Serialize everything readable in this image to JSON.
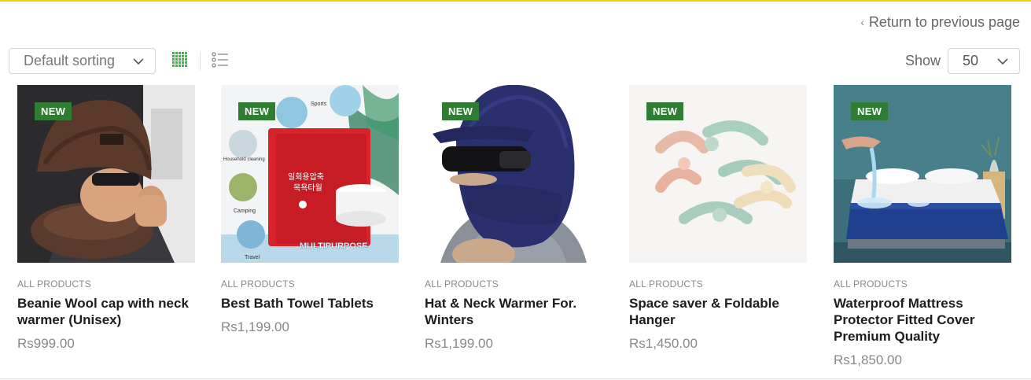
{
  "nav": {
    "return_label": "Return to previous page"
  },
  "toolbar": {
    "sort_value": "Default sorting",
    "show_label": "Show",
    "show_value": "50"
  },
  "products": [
    {
      "badge": "NEW",
      "category": "ALL PRODUCTS",
      "title": "Beanie Wool cap with neck warmer (Unisex)",
      "price": "Rs999.00"
    },
    {
      "badge": "NEW",
      "category": "ALL PRODUCTS",
      "title": "Best Bath Towel Tablets",
      "price": "Rs1,199.00",
      "image_text": {
        "sports": "Sports",
        "household": "Household cleaning",
        "camping": "Camping",
        "travel": "Travel",
        "banner": "MULTIPURPOSE",
        "pack_line1": "일회용압축",
        "pack_line2": "목욕타월"
      }
    },
    {
      "badge": "NEW",
      "category": "ALL PRODUCTS",
      "title": "Hat & Neck Warmer For. Winters",
      "price": "Rs1,199.00"
    },
    {
      "badge": "NEW",
      "category": "ALL PRODUCTS",
      "title": "Space saver & Foldable Hanger",
      "price": "Rs1,450.00"
    },
    {
      "badge": "NEW",
      "category": "ALL PRODUCTS",
      "title": "Waterproof Mattress Protector Fitted Cover Premium Quality",
      "price": "Rs1,850.00"
    }
  ],
  "colors": {
    "accent_line": "#f2d400",
    "badge_green": "#2f7d32",
    "grid_icon_green": "#4caf50"
  },
  "icons": [
    "chevron-left-icon",
    "chevron-down-icon",
    "grid-view-icon",
    "list-view-icon"
  ]
}
